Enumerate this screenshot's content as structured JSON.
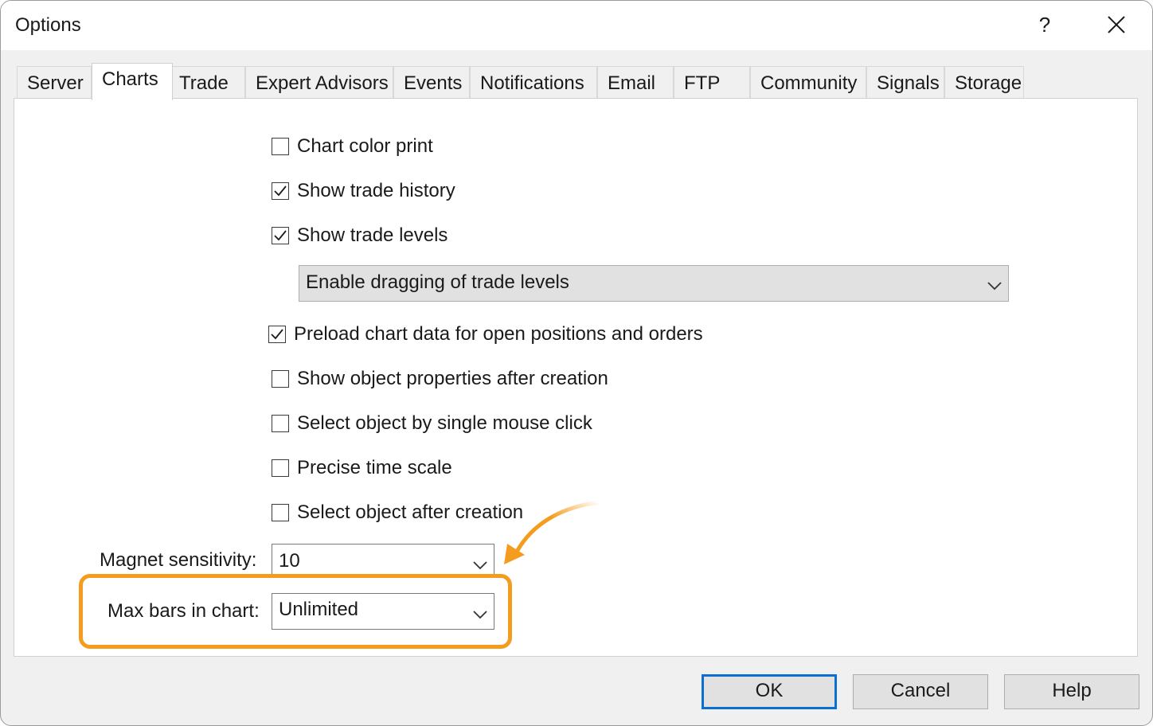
{
  "window": {
    "title": "Options",
    "help_glyph": "?",
    "close_icon": "close-icon"
  },
  "tabs": [
    {
      "label": "Server",
      "active": false
    },
    {
      "label": "Charts",
      "active": true
    },
    {
      "label": "Trade",
      "active": false
    },
    {
      "label": "Expert Advisors",
      "active": false
    },
    {
      "label": "Events",
      "active": false
    },
    {
      "label": "Notifications",
      "active": false
    },
    {
      "label": "Email",
      "active": false
    },
    {
      "label": "FTP",
      "active": false
    },
    {
      "label": "Community",
      "active": false
    },
    {
      "label": "Signals",
      "active": false
    },
    {
      "label": "Storage",
      "active": false
    }
  ],
  "checkboxes": {
    "chart_color_print": {
      "label": "Chart color print",
      "checked": false
    },
    "show_trade_history": {
      "label": "Show trade history",
      "checked": true
    },
    "show_trade_levels": {
      "label": "Show trade levels",
      "checked": true
    },
    "preload_chart_data": {
      "label": "Preload chart data for open positions and orders",
      "checked": true
    },
    "show_object_properties": {
      "label": "Show object properties after creation",
      "checked": false
    },
    "select_by_single_click": {
      "label": "Select object by single mouse click",
      "checked": false
    },
    "precise_time_scale": {
      "label": "Precise time scale",
      "checked": false
    },
    "select_after_creation": {
      "label": "Select object after creation",
      "checked": false
    }
  },
  "trade_levels_dropdown": {
    "value": "Enable dragging of trade levels"
  },
  "magnet_sensitivity": {
    "label": "Magnet sensitivity:",
    "value": "10"
  },
  "max_bars": {
    "label": "Max bars in chart:",
    "value": "Unlimited"
  },
  "buttons": {
    "ok": "OK",
    "cancel": "Cancel",
    "help": "Help"
  },
  "colors": {
    "highlight": "#f39c1e",
    "default_button_border": "#0a6fd1"
  }
}
